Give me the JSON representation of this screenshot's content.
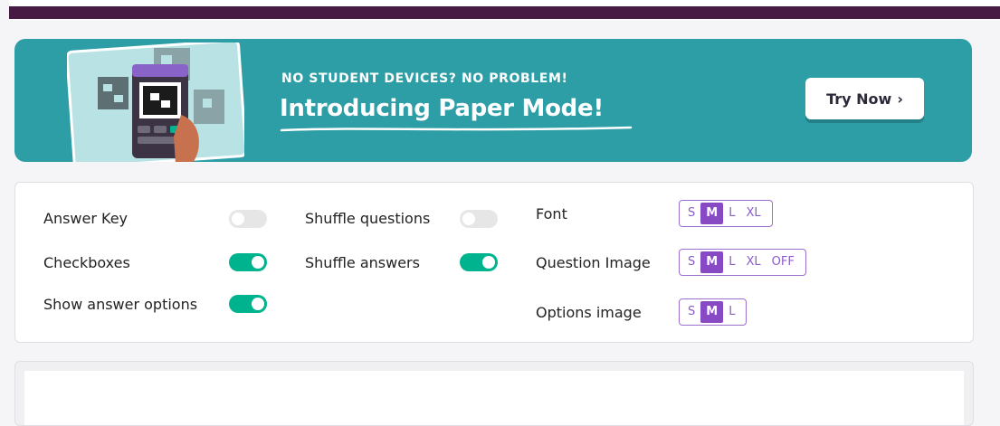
{
  "banner": {
    "kicker": "NO STUDENT DEVICES? NO PROBLEM!",
    "title": "Introducing Paper Mode!",
    "button_label": "Try Now",
    "button_icon": "chevron-right-icon"
  },
  "settings": {
    "toggles": [
      {
        "label": "Answer Key",
        "on": false
      },
      {
        "label": "Checkboxes",
        "on": true
      },
      {
        "label": "Show answer options",
        "on": true
      },
      {
        "label": "Shuffle questions",
        "on": false
      },
      {
        "label": "Shuffle answers",
        "on": true
      }
    ],
    "size_groups": [
      {
        "label": "Font",
        "options": [
          "S",
          "M",
          "L",
          "XL"
        ],
        "selected": "M"
      },
      {
        "label": "Question Image",
        "options": [
          "S",
          "M",
          "L",
          "XL",
          "OFF"
        ],
        "selected": "M"
      },
      {
        "label": "Options image",
        "options": [
          "S",
          "M",
          "L"
        ],
        "selected": "M"
      }
    ]
  },
  "colors": {
    "topbar": "#461a42",
    "banner": "#2d9da6",
    "toggle_on": "#00b38f",
    "toggle_off": "#e6e6e6",
    "accent": "#8849c5"
  }
}
